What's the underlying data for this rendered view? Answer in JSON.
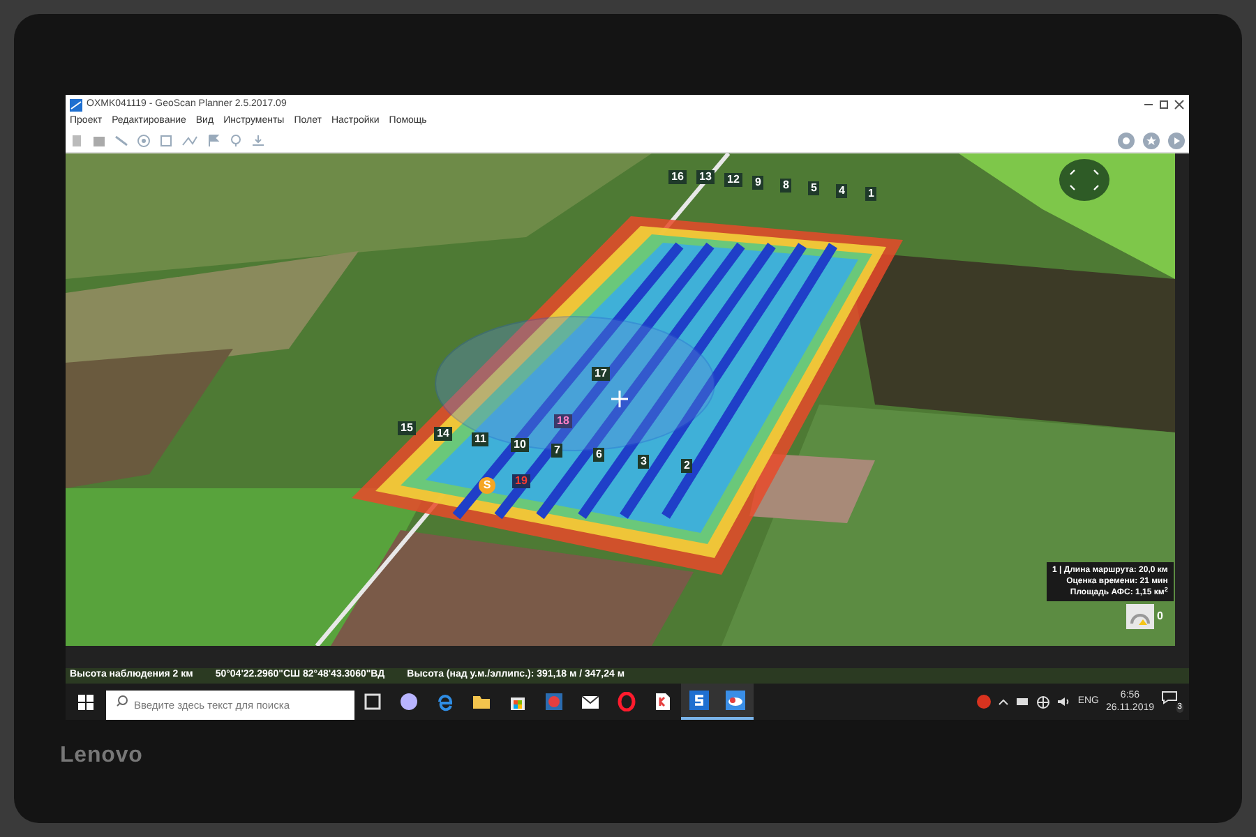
{
  "window": {
    "title": "OXMK041119 - GeoScan Planner 2.5.2017.09"
  },
  "menu": [
    "Проект",
    "Редактирование",
    "Вид",
    "Инструменты",
    "Полет",
    "Настройки",
    "Помощь"
  ],
  "map": {
    "waypoints": [
      {
        "label": "16",
        "kind": "normal"
      },
      {
        "label": "13",
        "kind": "normal"
      },
      {
        "label": "12",
        "kind": "normal"
      },
      {
        "label": "9",
        "kind": "normal"
      },
      {
        "label": "8",
        "kind": "normal"
      },
      {
        "label": "5",
        "kind": "normal"
      },
      {
        "label": "4",
        "kind": "normal"
      },
      {
        "label": "1",
        "kind": "normal"
      },
      {
        "label": "17",
        "kind": "normal"
      },
      {
        "label": "15",
        "kind": "normal"
      },
      {
        "label": "14",
        "kind": "normal"
      },
      {
        "label": "11",
        "kind": "normal"
      },
      {
        "label": "10",
        "kind": "normal"
      },
      {
        "label": "18",
        "kind": "highlighted"
      },
      {
        "label": "7",
        "kind": "normal"
      },
      {
        "label": "6",
        "kind": "normal"
      },
      {
        "label": "3",
        "kind": "normal"
      },
      {
        "label": "2",
        "kind": "normal"
      },
      {
        "label": "19",
        "kind": "alert"
      }
    ],
    "start_marker": "S",
    "info": [
      "1 | Длина маршрута: 20,0 км",
      "Оценка времени: 21 мин",
      "Площадь АФС: 1,15 км$^{2}$"
    ],
    "gauge_count": "0"
  },
  "status_bar": [
    "Высота наблюдения 2 км",
    "50°04'22.2960\"СШ 82°48'43.3060\"ВД",
    "Высота (над у.м./эллипс.): 391,18 м / 347,24 м"
  ],
  "taskbar": {
    "search": {
      "placeholder": "Введите здесь текст для поиска"
    },
    "apps": [
      {
        "kind": "task-view",
        "running": false
      },
      {
        "kind": "cortana",
        "running": false
      },
      {
        "kind": "edge",
        "running": false
      },
      {
        "kind": "folder",
        "running": false
      },
      {
        "kind": "store",
        "running": false
      },
      {
        "kind": "red-app",
        "running": false
      },
      {
        "kind": "mail",
        "running": false
      },
      {
        "kind": "opera",
        "running": false
      },
      {
        "kind": "document",
        "running": false
      },
      {
        "kind": "s-app",
        "running": true
      },
      {
        "kind": "planner",
        "running": true
      }
    ],
    "language": "ENG",
    "time": "6:56",
    "date": "26.11.2019",
    "notifications": "3"
  },
  "bezel": {
    "brand": "Lenovo"
  }
}
